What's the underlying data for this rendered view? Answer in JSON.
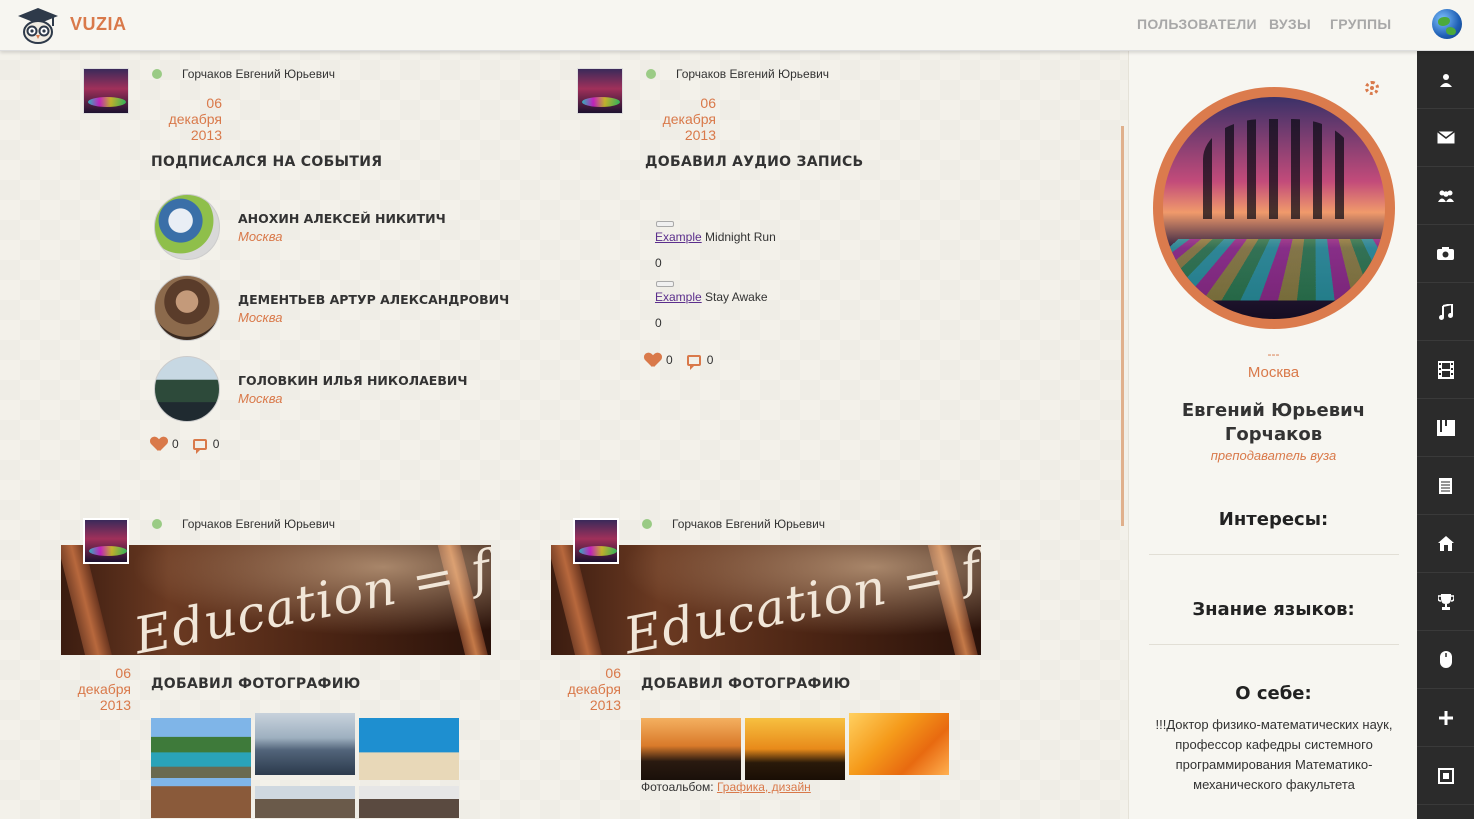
{
  "topbar": {
    "brand": "VUZIA",
    "nav": [
      "ПОЛЬЗОВАТЕЛИ",
      "ВУЗЫ",
      "ГРУППЫ"
    ]
  },
  "posts": [
    {
      "author": "Горчаков Евгений Юрьевич",
      "date_day": "06",
      "date_month": "декабря",
      "date_year": "2013",
      "action": "ПОДПИСАЛСЯ НА СОБЫТИЯ",
      "people": [
        {
          "name": "АНОХИН АЛЕКСЕЙ НИКИТИЧ",
          "city": "Москва"
        },
        {
          "name": "ДЕМЕНТЬЕВ АРТУР АЛЕКСАНДРОВИЧ",
          "city": "Москва"
        },
        {
          "name": "ГОЛОВКИН ИЛЬЯ НИКОЛАЕВИЧ",
          "city": "Москва"
        }
      ],
      "likes": "0",
      "comments": "0"
    },
    {
      "author": "Горчаков Евгений Юрьевич",
      "date_day": "06",
      "date_month": "декабря",
      "date_year": "2013",
      "action": "ДОБАВИЛ АУДИО ЗАПИСЬ",
      "tracks": [
        {
          "artist": "Example",
          "title": "Midnight Run",
          "count": "0"
        },
        {
          "artist": "Example",
          "title": "Stay Awake",
          "count": "0"
        }
      ],
      "likes": "0",
      "comments": "0"
    },
    {
      "author": "Горчаков Евгений Юрьевич",
      "banner_text": "Education = fun",
      "date_day": "06",
      "date_month": "декабря",
      "date_year": "2013",
      "action": "ДОБАВИЛ ФОТОГРАФИЮ"
    },
    {
      "author": "Горчаков Евгений Юрьевич",
      "banner_text": "Education = fun",
      "date_day": "06",
      "date_month": "декабря",
      "date_year": "2013",
      "action": "ДОБАВИЛ ФОТОГРАФИЮ",
      "album_label": "Фотоальбом:",
      "album_link": "Графика, дизайн"
    }
  ],
  "profile": {
    "dash": "---",
    "city": "Москва",
    "name": "Евгений Юрьевич Горчаков",
    "role": "преподаватель вуза",
    "interests_title": "Интересы:",
    "languages_title": "Знание языков:",
    "about_title": "О себе:",
    "about_text": "!!!Доктор физико-математических наук, профессор кафедры системного программирования Математико-механического факультета"
  },
  "iconbar": [
    "user-icon",
    "mail-icon",
    "group-icon",
    "camera-icon",
    "music-icon",
    "film-icon",
    "book-icon",
    "document-icon",
    "home-icon",
    "trophy-icon",
    "mouse-icon",
    "plus-icon",
    "fullscreen-icon"
  ],
  "colors": {
    "accent": "#d9794a",
    "online": "#9acb85",
    "sidebar": "#2b2b2b"
  }
}
